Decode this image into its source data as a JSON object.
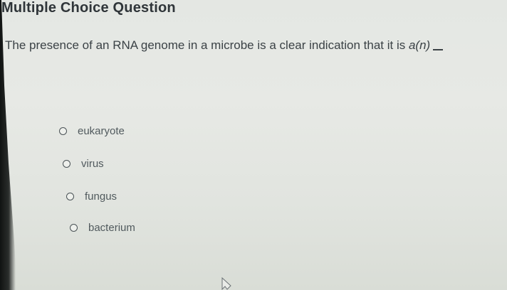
{
  "header": {
    "title": "Multiple Choice Question"
  },
  "question": {
    "text": "The presence of an RNA genome in a microbe is a clear indication that it is ",
    "emphasis": "a(n)"
  },
  "options": [
    {
      "label": "eukaryote",
      "selected": false
    },
    {
      "label": "virus",
      "selected": false
    },
    {
      "label": "fungus",
      "selected": false
    },
    {
      "label": "bacterium",
      "selected": false
    }
  ],
  "cursor_icon": "pointer-arrow-icon"
}
